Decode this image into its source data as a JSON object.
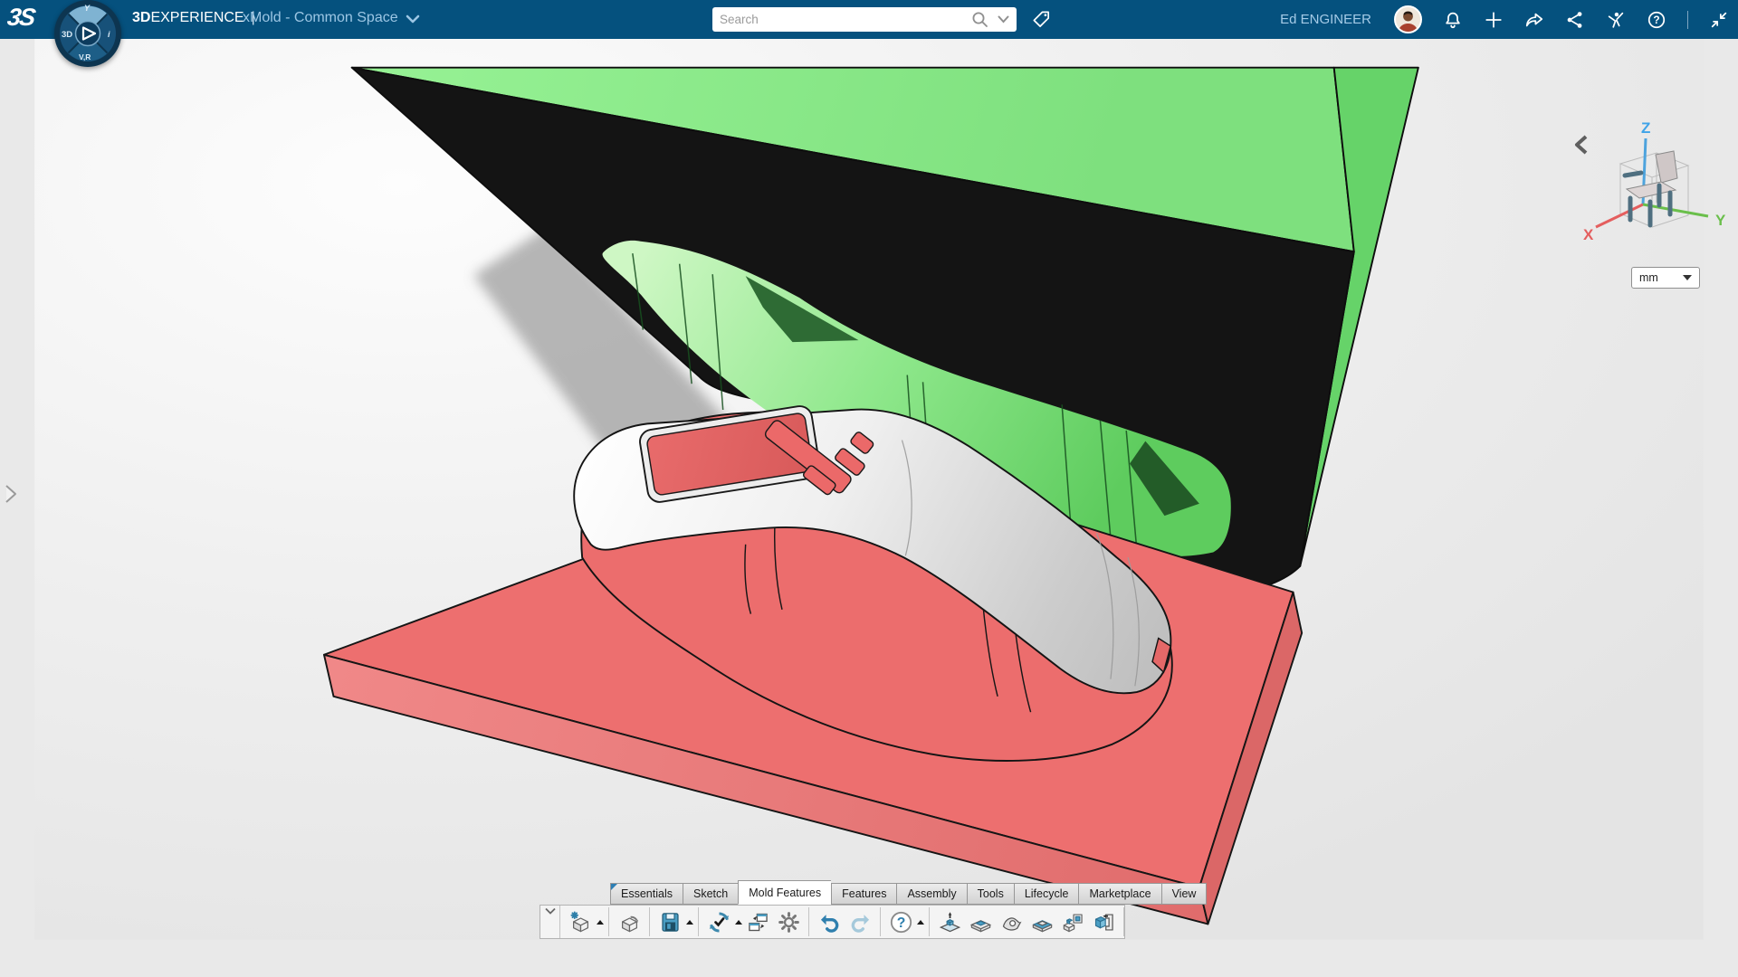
{
  "topbar": {
    "logo": "3S",
    "brand": {
      "bold": "3D",
      "rest": "EXPERIENCE",
      "divider": "|"
    },
    "app_title": "xMold - Common Space",
    "search": {
      "placeholder": "Search"
    },
    "user": {
      "name": "Ed ENGINEER"
    },
    "compass": {
      "west": "3D",
      "south": "V,R",
      "north": "Y",
      "east": "i"
    },
    "actions": [
      "notifications-bell-icon",
      "add-plus-icon",
      "share-arrow-icon",
      "share-nodes-icon",
      "swym-community-icon",
      "help-circle-icon",
      "minimize-window-icon"
    ]
  },
  "viewport": {
    "units": {
      "value": "mm"
    },
    "triad": {
      "x": "X",
      "y": "Y",
      "z": "Z"
    },
    "colors": {
      "background": "#e9e9e9",
      "mold_top_face": "#8dea8c",
      "mold_top_side": "#66d369",
      "mold_underside": "#141414",
      "cavity_green": "#8fe88c",
      "base_plate_red": "#ed6f6f",
      "part_body": "#f4f4f4",
      "part_screen_red": "#e26262",
      "shadow_gray": "#9f9f9f"
    }
  },
  "ribbon": {
    "tabs": [
      {
        "label": "Essentials",
        "active": false,
        "marked": true
      },
      {
        "label": "Sketch",
        "active": false,
        "marked": false
      },
      {
        "label": "Mold Features",
        "active": true,
        "marked": false
      },
      {
        "label": "Features",
        "active": false,
        "marked": false
      },
      {
        "label": "Assembly",
        "active": false,
        "marked": false
      },
      {
        "label": "Tools",
        "active": false,
        "marked": false
      },
      {
        "label": "Lifecycle",
        "active": false,
        "marked": false
      },
      {
        "label": "Marketplace",
        "active": false,
        "marked": false
      },
      {
        "label": "View",
        "active": false,
        "marked": false
      }
    ],
    "toolbar_groups": [
      {
        "items": [
          {
            "icon": "new-part-icon",
            "caret": true
          }
        ]
      },
      {
        "items": [
          {
            "icon": "open-part-icon",
            "caret": false
          }
        ]
      },
      {
        "items": [
          {
            "icon": "save-icon",
            "caret": true
          }
        ]
      },
      {
        "items": [
          {
            "icon": "update-icon",
            "caret": true
          },
          {
            "icon": "swap-window-icon",
            "caret": false
          },
          {
            "icon": "settings-gear-icon",
            "caret": false
          }
        ]
      },
      {
        "items": [
          {
            "icon": "undo-icon",
            "caret": false
          },
          {
            "icon": "redo-icon",
            "caret": false
          }
        ]
      },
      {
        "items": [
          {
            "icon": "help-icon",
            "caret": true
          }
        ]
      },
      {
        "items": [
          {
            "icon": "mold-open-icon",
            "caret": false
          },
          {
            "icon": "mold-core-icon",
            "caret": false
          },
          {
            "icon": "mold-patch-icon",
            "caret": false
          },
          {
            "icon": "mold-cavity-icon",
            "caret": false
          },
          {
            "icon": "mold-components-icon",
            "caret": false
          },
          {
            "icon": "mold-insert-icon",
            "caret": false
          }
        ]
      }
    ]
  }
}
